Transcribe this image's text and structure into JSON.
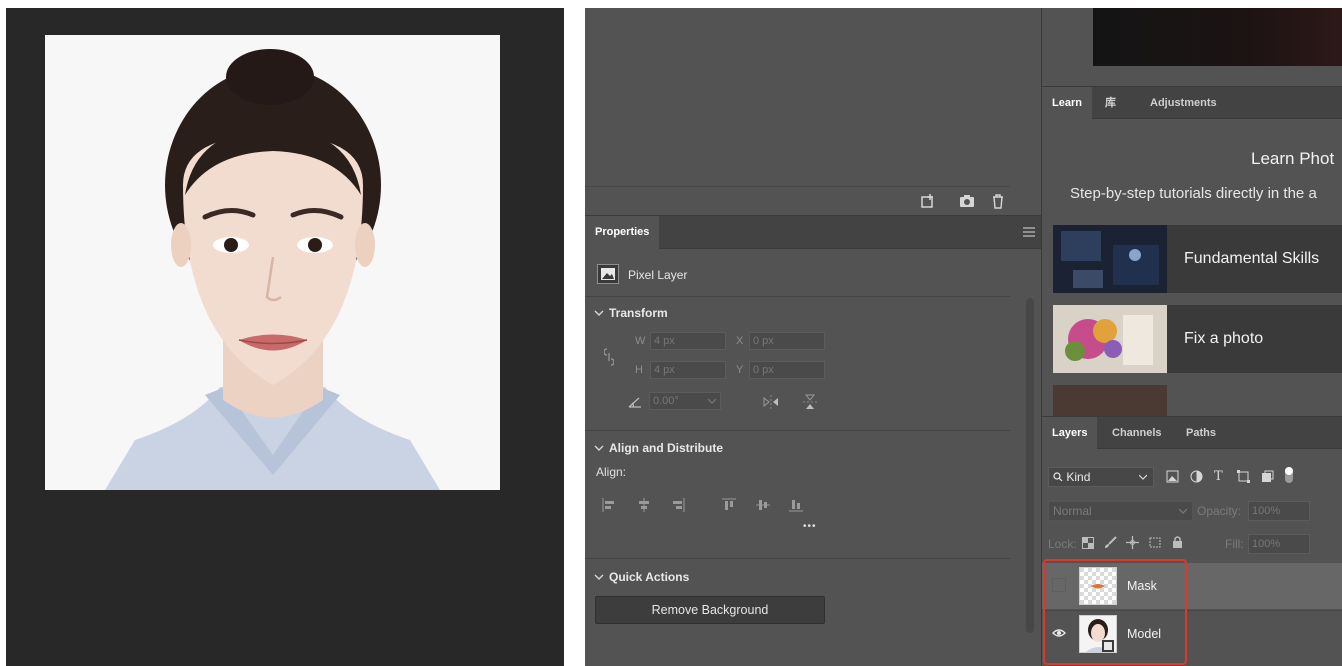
{
  "history_footer": {
    "icons": [
      "new-snapshot-icon",
      "camera-icon",
      "trash-icon"
    ]
  },
  "properties": {
    "tab_label": "Properties",
    "layer_type": "Pixel Layer",
    "transform": {
      "title": "Transform",
      "w_label": "W",
      "w_value": "4 px",
      "x_label": "X",
      "x_value": "0 px",
      "h_label": "H",
      "h_value": "4 px",
      "y_label": "Y",
      "y_value": "0 px",
      "angle_value": "0.00°"
    },
    "align": {
      "title": "Align and Distribute",
      "label": "Align:",
      "more": "•••"
    },
    "quick_actions": {
      "title": "Quick Actions",
      "remove_bg": "Remove Background"
    }
  },
  "learn": {
    "tabs": [
      "Learn",
      "库",
      "Adjustments"
    ],
    "title": "Learn Phot",
    "subtitle": "Step-by-step tutorials directly in the a",
    "tutorials": [
      {
        "label": "Fundamental Skills"
      },
      {
        "label": "Fix a photo"
      }
    ]
  },
  "layers": {
    "tabs": [
      "Layers",
      "Channels",
      "Paths"
    ],
    "kind_label": "Kind",
    "blend_mode": "Normal",
    "opacity_label": "Opacity:",
    "opacity_value": "100%",
    "lock_label": "Lock:",
    "fill_label": "Fill:",
    "fill_value": "100%",
    "items": [
      {
        "name": "Mask",
        "visible": false
      },
      {
        "name": "Model",
        "visible": true
      }
    ]
  },
  "colors": {
    "highlight": "#e0372b",
    "panel_bg": "#535353",
    "canvas_bg": "#282828"
  }
}
